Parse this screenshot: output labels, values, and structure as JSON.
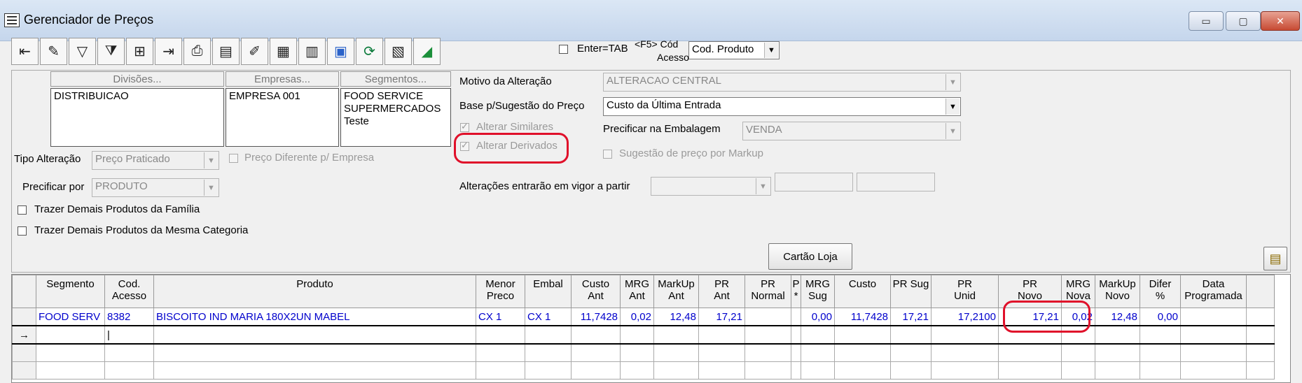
{
  "window": {
    "title": "Gerenciador de Preços",
    "buttons": [
      "▭",
      "▢",
      "✕"
    ]
  },
  "toolbar": {
    "icons": [
      "exit-icon",
      "eraser-icon",
      "filter-icon",
      "filter-advanced-icon",
      "add-row-icon",
      "export-icon",
      "print-icon",
      "preview-icon",
      "edit-list-icon",
      "grid-insert-icon",
      "sheet-icon",
      "save-icon",
      "refresh-icon",
      "calculator-icon",
      "chart-icon"
    ],
    "enter_tab_label": "Enter=TAB",
    "f5_label_line1": "<F5> Cód",
    "f5_label_line2": "Acesso",
    "cod_select_value": "Cod. Produto"
  },
  "filters": {
    "divisoes_header": "Divisões...",
    "empresas_header": "Empresas...",
    "segmentos_header": "Segmentos...",
    "divisoes_items": [
      "DISTRIBUICAO"
    ],
    "empresas_items": [
      "EMPRESA 001"
    ],
    "segmentos_items": [
      "FOOD SERVICE",
      "SUPERMERCADOS",
      "Teste"
    ],
    "tipo_alteracao_label": "Tipo Alteração",
    "tipo_alteracao_value": "Preço Praticado",
    "preco_diferente_label": "Preço Diferente p/ Empresa",
    "precificar_por_label": "Precificar por",
    "precificar_por_value": "PRODUTO",
    "trazer_familia_label": "Trazer Demais Produtos da Família",
    "trazer_categoria_label": "Trazer Demais Produtos da Mesma Categoria"
  },
  "options": {
    "motivo_label": "Motivo da Alteração",
    "motivo_value": "ALTERACAO CENTRAL",
    "base_label": "Base p/Sugestão do Preço",
    "base_value": "Custo da Última Entrada",
    "alterar_similares_label": "Alterar Similares",
    "alterar_derivados_label": "Alterar Derivados",
    "precificar_embalagem_label": "Precificar na Embalagem",
    "precificar_embalagem_value": "VENDA",
    "sugestao_markup_label": "Sugestão de preço por Markup",
    "vigor_label": "Alterações entrarão em vigor a partir",
    "cartao_loja_button": "Cartão Loja"
  },
  "grid": {
    "columns": [
      "",
      "Segmento",
      "Cod.\nAcesso",
      "Produto",
      "Menor\nPreco",
      "Embal",
      "Custo\nAnt",
      "MRG\nAnt",
      "MarkUp\nAnt",
      "PR\nAnt",
      "PR\nNormal",
      "P\n*",
      "MRG\nSug",
      "Custo",
      "PR Sug",
      "PR\nUnid",
      "PR\nNovo",
      "MRG\nNova",
      "MarkUp\nNovo",
      "Difer\n%",
      "Data\nProgramada"
    ],
    "rows": [
      [
        "",
        "FOOD SERV",
        "8382",
        "BISCOITO IND MARIA 180X2UN MABEL",
        "CX 1",
        "CX 1",
        "11,7428",
        "0,02",
        "12,48",
        "17,21",
        "",
        "",
        "0,00",
        "11,7428",
        "17,21",
        "17,2100",
        "17,21",
        "0,02",
        "12,48",
        "0,00",
        ""
      ],
      [
        "→",
        "",
        "|",
        "",
        "",
        "",
        "",
        "",
        "",
        "",
        "",
        "",
        "",
        "",
        "",
        "",
        "",
        "",
        "",
        "",
        ""
      ],
      [
        "",
        "",
        "",
        "",
        "",
        "",
        "",
        "",
        "",
        "",
        "",
        "",
        "",
        "",
        "",
        "",
        "",
        "",
        "",
        "",
        ""
      ],
      [
        "",
        "",
        "",
        "",
        "",
        "",
        "",
        "",
        "",
        "",
        "",
        "",
        "",
        "",
        "",
        "",
        "",
        "",
        "",
        "",
        ""
      ]
    ]
  },
  "colors": {
    "annotation": "#e0102a",
    "grid_text": "#0000cc"
  }
}
